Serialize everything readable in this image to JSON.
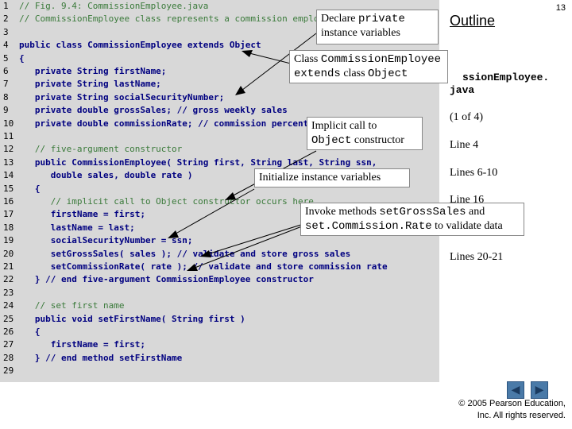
{
  "page_number": "13",
  "outline_title": "Outline",
  "code": [
    {
      "n": "1",
      "text": "// Fig. 9.4: CommissionEmployee.java",
      "style": "comment"
    },
    {
      "n": "2",
      "text": "// CommissionEmployee class represents a commission employee.",
      "style": "comment"
    },
    {
      "n": "3",
      "text": "",
      "style": "code"
    },
    {
      "n": "4",
      "text": "public class CommissionEmployee extends Object",
      "style": "code"
    },
    {
      "n": "5",
      "text": "{",
      "style": "code"
    },
    {
      "n": "6",
      "text": "   private String firstName;",
      "style": "code"
    },
    {
      "n": "7",
      "text": "   private String lastName;",
      "style": "code"
    },
    {
      "n": "8",
      "text": "   private String socialSecurityNumber;",
      "style": "code"
    },
    {
      "n": "9",
      "text": "   private double grossSales; // gross weekly sales",
      "style": "code"
    },
    {
      "n": "10",
      "text": "   private double commissionRate; // commission percentage",
      "style": "code"
    },
    {
      "n": "11",
      "text": "",
      "style": "code"
    },
    {
      "n": "12",
      "text": "   // five-argument constructor",
      "style": "comment"
    },
    {
      "n": "13",
      "text": "   public CommissionEmployee( String first, String last, String ssn,",
      "style": "code"
    },
    {
      "n": "14",
      "text": "      double sales, double rate )",
      "style": "code"
    },
    {
      "n": "15",
      "text": "   {",
      "style": "code"
    },
    {
      "n": "16",
      "text": "      // implicit call to Object constructor occurs here",
      "style": "comment"
    },
    {
      "n": "17",
      "text": "      firstName = first;",
      "style": "code"
    },
    {
      "n": "18",
      "text": "      lastName = last;",
      "style": "code"
    },
    {
      "n": "19",
      "text": "      socialSecurityNumber = ssn;",
      "style": "code"
    },
    {
      "n": "20",
      "text": "      setGrossSales( sales ); // validate and store gross sales",
      "style": "code"
    },
    {
      "n": "21",
      "text": "      setCommissionRate( rate ); // validate and store commission rate",
      "style": "code"
    },
    {
      "n": "22",
      "text": "   } // end five-argument CommissionEmployee constructor",
      "style": "code"
    },
    {
      "n": "23",
      "text": "",
      "style": "code"
    },
    {
      "n": "24",
      "text": "   // set first name",
      "style": "comment"
    },
    {
      "n": "25",
      "text": "   public void setFirstName( String first )",
      "style": "code"
    },
    {
      "n": "26",
      "text": "   {",
      "style": "code"
    },
    {
      "n": "27",
      "text": "      firstName = first;",
      "style": "code"
    },
    {
      "n": "28",
      "text": "   } // end method setFirstName",
      "style": "code"
    },
    {
      "n": "29",
      "text": "",
      "style": "code"
    }
  ],
  "callouts": {
    "declare_prefix": "Declare ",
    "declare_mono": "private",
    "declare_suffix": "instance variables",
    "class_prefix": "Class ",
    "class_mono1": "CommissionEmployee",
    "class_mid": "extends",
    "class_after": " class ",
    "class_mono2": "Object",
    "implicit_line1": "Implicit call to",
    "implicit_mono": "Object",
    "implicit_suffix": " constructor",
    "init": "Initialize instance variables",
    "invoke_prefix": "Invoke methods ",
    "invoke_mono1": "setGrossSales",
    "invoke_mid": " and",
    "invoke_mono2": "set.Commission.Rate",
    "invoke_suffix": " to validate data"
  },
  "sidebar": {
    "filename_part1": "ssionEmployee.",
    "filename_part2": "java",
    "page_of": "(1 of 4)",
    "line4": "Line 4",
    "lines6_10": "Lines 6-10",
    "line16": "Line 16",
    "lines20_21": "Lines 20-21"
  },
  "copyright_line1": "© 2005 Pearson Education,",
  "copyright_line2": "Inc.  All rights reserved."
}
